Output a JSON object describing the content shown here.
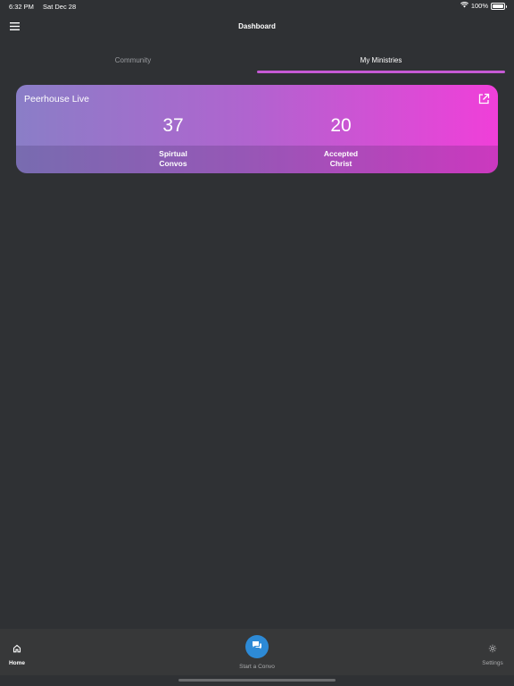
{
  "status_bar": {
    "time": "6:32 PM",
    "date": "Sat Dec 28",
    "battery": "100%"
  },
  "header": {
    "title": "Dashboard"
  },
  "tabs": [
    {
      "label": "Community",
      "active": false
    },
    {
      "label": "My Ministries",
      "active": true
    }
  ],
  "ministry_card": {
    "title": "Peerhouse Live",
    "stats": [
      {
        "value": "37",
        "label_line1": "Spirtual",
        "label_line2": "Convos"
      },
      {
        "value": "20",
        "label_line1": "Accepted",
        "label_line2": "Christ"
      }
    ]
  },
  "bottom_bar": {
    "home_label": "Home",
    "start_convo_label": "Start a Convo",
    "settings_label": "Settings"
  },
  "colors": {
    "background": "#2f3134",
    "accent_tab": "#c65ad5",
    "fab": "#2d8ad6",
    "card_gradient_start": "#8a7ec7",
    "card_gradient_end": "#f03fd9"
  },
  "icons": [
    "wifi-icon",
    "battery-icon",
    "hamburger-menu-icon",
    "external-link-icon",
    "home-icon",
    "chat-bubbles-icon",
    "gear-icon"
  ]
}
